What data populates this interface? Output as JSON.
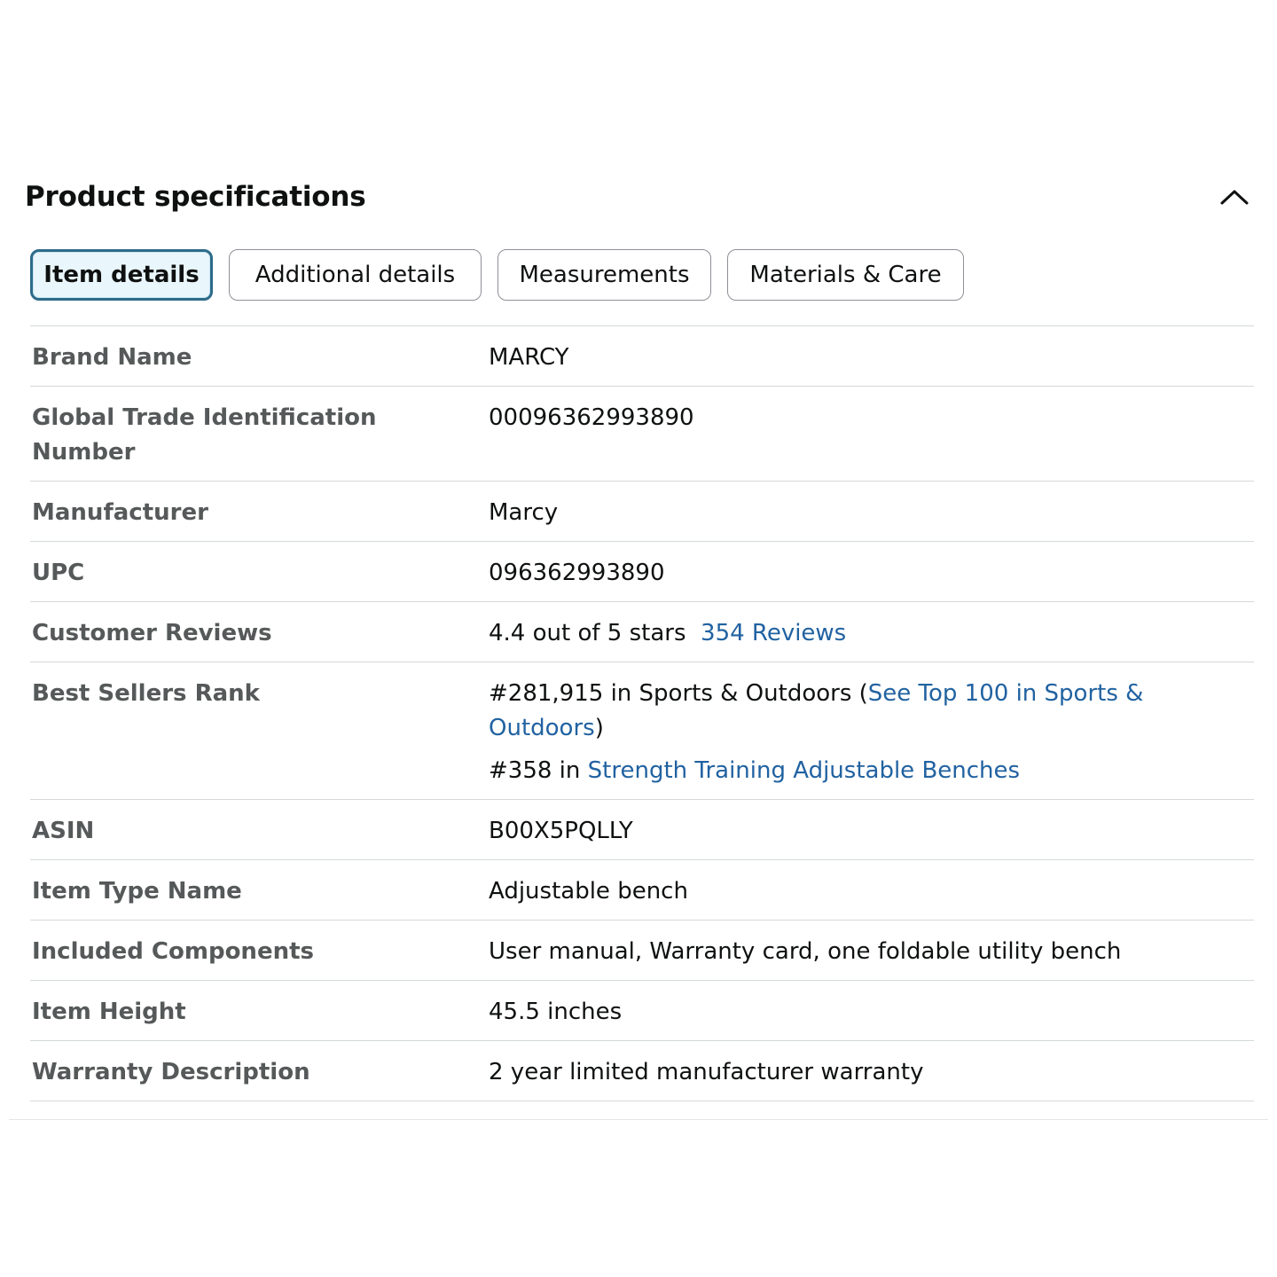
{
  "section": {
    "title": "Product specifications"
  },
  "tabs": [
    {
      "label": "Item details",
      "active": true
    },
    {
      "label": "Additional details",
      "active": false
    },
    {
      "label": "Measurements",
      "active": false
    },
    {
      "label": "Materials & Care",
      "active": false
    }
  ],
  "rows": {
    "brand": {
      "label": "Brand Name",
      "value": "MARCY"
    },
    "gtin": {
      "label": "Global Trade Identification Number",
      "value": "00096362993890"
    },
    "manufacturer": {
      "label": "Manufacturer",
      "value": "Marcy"
    },
    "upc": {
      "label": "UPC",
      "value": "096362993890"
    },
    "reviews": {
      "label": "Customer Reviews",
      "value": "4.4 out of 5 stars",
      "link": "354 Reviews"
    },
    "rank": {
      "label": "Best Sellers Rank",
      "line1_text": "#281,915 in Sports & Outdoors (",
      "line1_link": "See Top 100 in Sports & Outdoors",
      "line1_close": ")",
      "line2_text": "#358 in ",
      "line2_link": "Strength Training Adjustable Benches"
    },
    "asin": {
      "label": "ASIN",
      "value": "B00X5PQLLY"
    },
    "item_type": {
      "label": "Item Type Name",
      "value": "Adjustable bench"
    },
    "components": {
      "label": "Included Components",
      "value": "User manual, Warranty card, one foldable utility bench"
    },
    "height": {
      "label": "Item Height",
      "value": "45.5 inches"
    },
    "warranty": {
      "label": "Warranty Description",
      "value": "2 year limited manufacturer warranty"
    }
  },
  "colors": {
    "link": "#2162a1",
    "active_tab_border": "#2d6b8a",
    "active_tab_bg": "#e9f6fb",
    "label": "#565959",
    "divider": "#d5d9d9"
  },
  "icons": {
    "collapse": "chevron-up-icon"
  }
}
